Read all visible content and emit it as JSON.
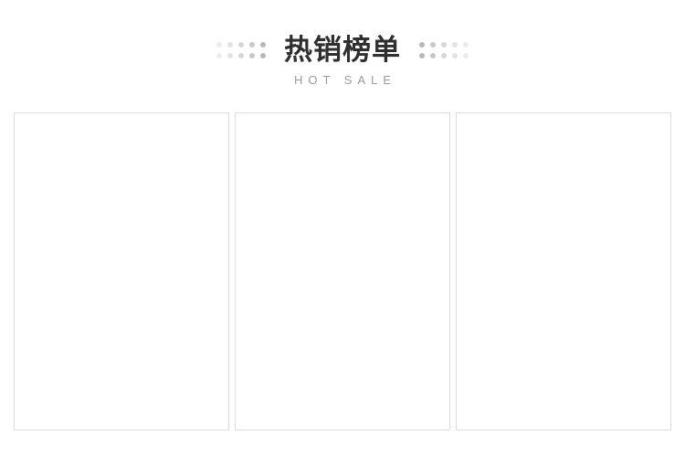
{
  "section": {
    "title": "热销榜单",
    "subtitle": "HOT SALE"
  },
  "products": [
    {
      "slot": 1
    },
    {
      "slot": 2
    },
    {
      "slot": 3
    }
  ],
  "colors": {
    "title": "#2f2f2f",
    "subtitle": "#9a9a9a",
    "card_border": "#dcdcdc",
    "background": "#ffffff"
  },
  "icons": {
    "left_decoration": "dot-grid-icon",
    "right_decoration": "dot-grid-icon"
  }
}
